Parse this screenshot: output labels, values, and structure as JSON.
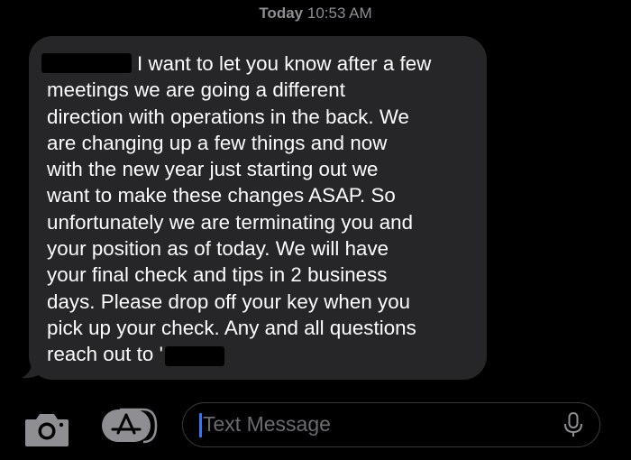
{
  "timestamp": {
    "day": "Today",
    "time": "10:53 AM"
  },
  "message": {
    "lines": [
      "I want to let you know after a few",
      "meetings we are going a different",
      "direction with operations in the back. We",
      "are changing up a few things and now",
      "with the new year just starting out we",
      "want to make these changes ASAP. So",
      "unfortunately we are terminating you and",
      "your position as of today. We will have",
      "your final check and tips in 2 business",
      "days. Please drop off your key when you",
      "pick up your check. Any and all questions",
      "reach out to '"
    ]
  },
  "composer": {
    "placeholder": "Text Message",
    "value": ""
  },
  "icons": {
    "camera": "camera-icon",
    "apps": "app-store-icon",
    "mic": "microphone-icon"
  },
  "colors": {
    "background": "#000000",
    "bubble": "#262628",
    "timestamp": "#8e8e93",
    "cursor": "#3478f6",
    "icon": "#8e8e93"
  }
}
